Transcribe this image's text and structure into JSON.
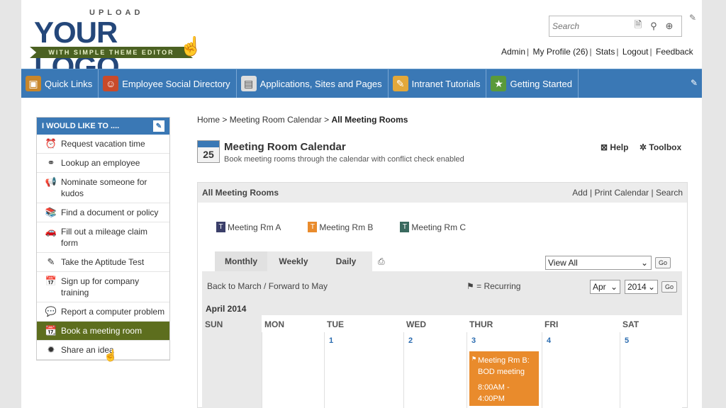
{
  "header": {
    "logo_upload": "UPLOAD",
    "logo_main": "YOUR LOGO",
    "logo_ribbon": "WITH SIMPLE THEME EDITOR",
    "search_placeholder": "Search",
    "links": [
      "Admin",
      "My Profile (26)",
      "Stats",
      "Logout",
      "Feedback"
    ]
  },
  "nav": {
    "items": [
      {
        "label": "Quick Links",
        "icon": "package-icon",
        "color": "#c8862a"
      },
      {
        "label": "Employee Social Directory",
        "icon": "people-icon",
        "color": "#c94a2a"
      },
      {
        "label": "Applications, Sites and Pages",
        "icon": "document-icon",
        "color": "#dddddd"
      },
      {
        "label": "Intranet Tutorials",
        "icon": "tutorial-icon",
        "color": "#e3a83a"
      },
      {
        "label": "Getting Started",
        "icon": "star-icon",
        "color": "#5a9a3a"
      }
    ]
  },
  "sidebar": {
    "title": "I WOULD LIKE TO ....",
    "items": [
      {
        "label": "Request vacation time",
        "icon": "alarm-clock-icon",
        "glyph": "⏰"
      },
      {
        "label": "Lookup an employee",
        "icon": "binoculars-icon",
        "glyph": "⚭"
      },
      {
        "label": "Nominate someone for kudos",
        "icon": "megaphone-icon",
        "glyph": "📢"
      },
      {
        "label": "Find a document or policy",
        "icon": "books-icon",
        "glyph": "📚"
      },
      {
        "label": "Fill out a mileage claim form",
        "icon": "car-icon",
        "glyph": "🚗"
      },
      {
        "label": "Take the Aptitude Test",
        "icon": "pen-icon",
        "glyph": "✎"
      },
      {
        "label": "Sign up for company training",
        "icon": "calendar-icon",
        "glyph": "📅"
      },
      {
        "label": "Report a computer problem",
        "icon": "chat-icon",
        "glyph": "💬"
      },
      {
        "label": "Book a meeting room",
        "icon": "meeting-calendar-icon",
        "glyph": "📆",
        "active": true
      },
      {
        "label": "Share an idea",
        "icon": "lightbulb-icon",
        "glyph": "✹"
      }
    ]
  },
  "breadcrumb": {
    "home": "Home",
    "parent": "Meeting Room Calendar",
    "current": "All Meeting Rooms"
  },
  "page": {
    "icon_day": "25",
    "title": "Meeting Room Calendar",
    "subtitle": "Book meeting rooms through the calendar with conflict check enabled",
    "help": "Help",
    "toolbox": "Toolbox"
  },
  "panel": {
    "title": "All Meeting Rooms",
    "actions": [
      "Add",
      "Print Calendar",
      "Search"
    ],
    "legend": [
      {
        "label": "Meeting Rm A",
        "color": "#3b3f6a"
      },
      {
        "label": "Meeting Rm B",
        "color": "#e98b2c"
      },
      {
        "label": "Meeting Rm C",
        "color": "#3a6a5f"
      }
    ],
    "tabs": [
      "Monthly",
      "Weekly",
      "Daily"
    ],
    "view_select": "View All",
    "go": "Go",
    "back_forward": "Back to March / Forward to May",
    "recurring": "= Recurring",
    "month_select": "Apr",
    "year_select": "2014",
    "month_label": "April 2014",
    "days": [
      "SUN",
      "MON",
      "TUE",
      "WED",
      "THUR",
      "FRI",
      "SAT"
    ],
    "dates": [
      "",
      "",
      "1",
      "2",
      "3",
      "4",
      "5"
    ],
    "event": {
      "title": "Meeting Rm B: BOD meeting",
      "time": "8:00AM - 4:00PM",
      "color": "#e98b2c"
    }
  }
}
